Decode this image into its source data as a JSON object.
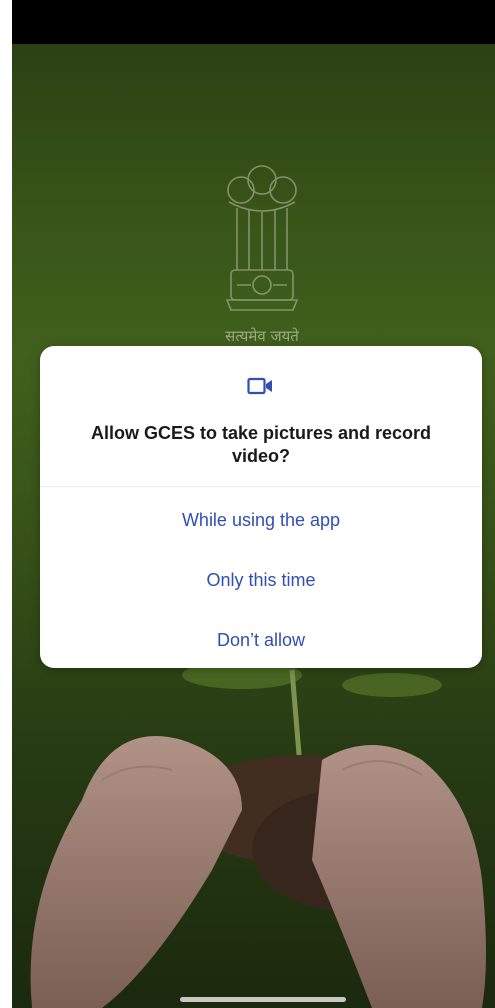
{
  "background": {
    "motto": "सत्यमेव जयते"
  },
  "dialog": {
    "icon": "video-camera-icon",
    "title": "Allow GCES to take pictures and record video?",
    "options": [
      {
        "label": "While using the app"
      },
      {
        "label": "Only this time"
      },
      {
        "label": "Don’t allow"
      }
    ]
  },
  "colors": {
    "accent": "#2f4fb3",
    "dialog_background": "#ffffff",
    "title_text": "#1a1a1a",
    "status_bar": "#000000",
    "background_green": "#4a6e20"
  }
}
